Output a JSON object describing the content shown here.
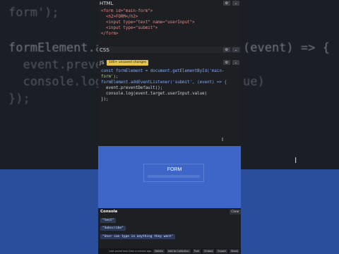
{
  "background_code": {
    "line1_a": "form');",
    "line2_a": "formElement.add",
    "line2_b": "(event) => {",
    "line3": "  event.prevent",
    "line4_a": "  console.log(",
    "line4_b": "ue)",
    "line5": "});"
  },
  "html_panel": {
    "title": "HTML",
    "lines": [
      "<form id=\"main-form\">",
      "  <h2>FORM</h2>",
      "  <input type=\"text\" name=\"userInput\">",
      "  <input type=\"submit\">",
      "</form>"
    ]
  },
  "css_panel": {
    "title": "CSS"
  },
  "js_panel": {
    "title": "JS",
    "badge": "100+ unsaved changes",
    "lines": [
      "const formElement = document.getElementById('main-",
      "form');",
      "",
      "formElement.addEventListener('submit', (event) => {",
      "  event.preventDefault();",
      "  console.log(event.target.userInput.value)",
      "});"
    ]
  },
  "preview": {
    "form_title": "FORM"
  },
  "console": {
    "title": "Console",
    "clear_label": "Clear",
    "logs": [
      "\"test\"",
      "\"Subscribe\"",
      "\"User can type in anything they want\""
    ]
  },
  "footer": {
    "last_saved": "Last saved less than a minute ago",
    "buttons": [
      "Delete",
      "Add to Collection",
      "Fork",
      "Embed",
      "Export",
      "Share"
    ]
  },
  "colors": {
    "panel_bg": "#1d1f23",
    "preview_bg": "#3d66c8",
    "badge_bg": "#e8c547",
    "background_bottom": "#2a4e9c"
  }
}
